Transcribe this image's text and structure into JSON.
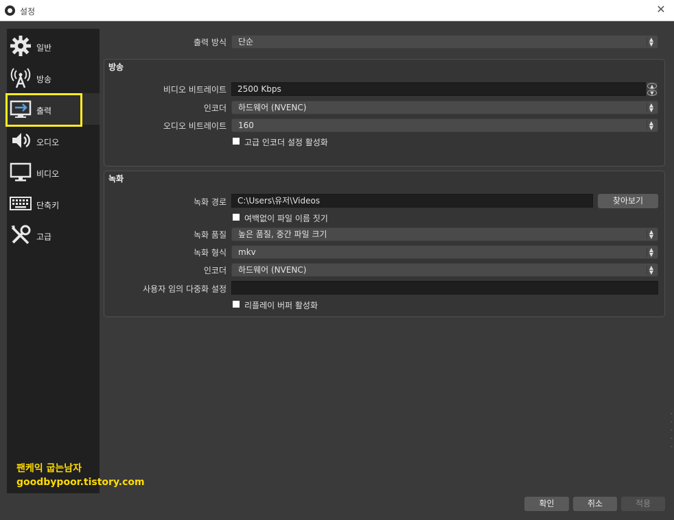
{
  "window": {
    "title": "설정"
  },
  "sidebar": {
    "items": [
      {
        "label": "일반",
        "icon": "gear-icon"
      },
      {
        "label": "방송",
        "icon": "broadcast-icon"
      },
      {
        "label": "출력",
        "icon": "output-icon",
        "active": true
      },
      {
        "label": "오디오",
        "icon": "speaker-icon"
      },
      {
        "label": "비디오",
        "icon": "monitor-icon"
      },
      {
        "label": "단축키",
        "icon": "keyboard-icon"
      },
      {
        "label": "고급",
        "icon": "tools-icon"
      }
    ]
  },
  "watermark": {
    "line1": "팬케익 굽는남자",
    "line2": "goodbypoor.tistory.com"
  },
  "output_mode": {
    "label": "출력 방식",
    "value": "단순"
  },
  "streaming": {
    "title": "방송",
    "video_bitrate": {
      "label": "비디오 비트레이트",
      "value": "2500 Kbps"
    },
    "encoder": {
      "label": "인코더",
      "value": "하드웨어 (NVENC)"
    },
    "audio_bitrate": {
      "label": "오디오 비트레이트",
      "value": "160"
    },
    "advanced_encoder": {
      "label": "고급 인코더 설정 활성화",
      "checked": false
    }
  },
  "recording": {
    "title": "녹화",
    "path": {
      "label": "녹화 경로",
      "value": "C:\\Users\\유저\\Videos",
      "browse": "찾아보기"
    },
    "no_space": {
      "label": "여백없이 파일 이름 짓기",
      "checked": false
    },
    "quality": {
      "label": "녹화 품질",
      "value": "높은 품질, 중간 파일 크기"
    },
    "format": {
      "label": "녹화 형식",
      "value": "mkv"
    },
    "encoder": {
      "label": "인코더",
      "value": "하드웨어 (NVENC)"
    },
    "muxer": {
      "label": "사용자 임의 다중화 설정",
      "value": ""
    },
    "replay_buffer": {
      "label": "리플레이 버퍼 활성화",
      "checked": false
    }
  },
  "buttons": {
    "ok": "확인",
    "cancel": "취소",
    "apply": "적용"
  }
}
